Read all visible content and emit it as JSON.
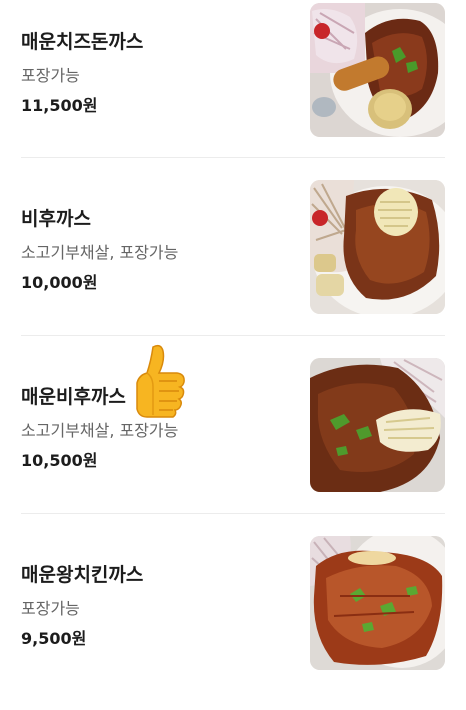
{
  "menu": {
    "items": [
      {
        "name": "매운치즈돈까스",
        "description": "포장가능",
        "price": "11,500원",
        "image": "fried-pork-cutlet-photo"
      },
      {
        "name": "비후까스",
        "description": "소고기부채살, 포장가능",
        "price": "10,000원",
        "image": "beef-cutlet-photo"
      },
      {
        "name": "매운비후까스",
        "description": "소고기부채살, 포장가능",
        "price": "10,500원",
        "image": "spicy-beef-cutlet-photo"
      },
      {
        "name": "매운왕치킨까스",
        "description": "포장가능",
        "price": "9,500원",
        "image": "spicy-chicken-cutlet-photo"
      }
    ]
  },
  "overlay": {
    "icon": "thumbs-up-icon"
  }
}
